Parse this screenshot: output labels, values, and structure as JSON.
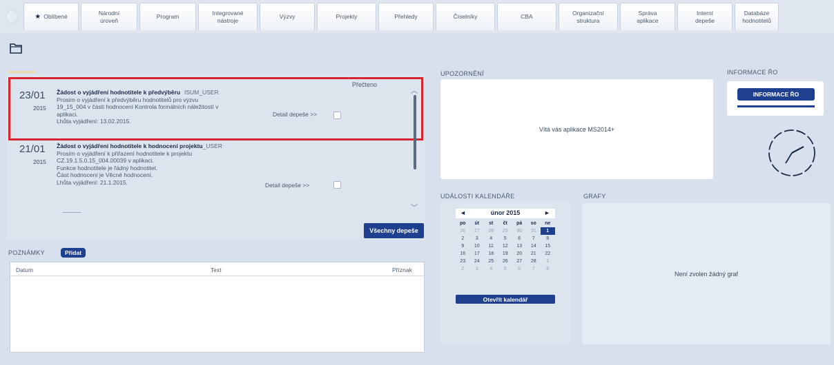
{
  "nav": {
    "tabs": [
      {
        "label": "Oblíbené",
        "icon": "star-icon"
      },
      {
        "label": "Národní\núroveň"
      },
      {
        "label": "Program"
      },
      {
        "label": "Integrované\nnástroje"
      },
      {
        "label": "Výzvy"
      },
      {
        "label": "Projekty"
      },
      {
        "label": "Přehledy"
      },
      {
        "label": "Číselníky"
      },
      {
        "label": "CBA"
      },
      {
        "label": "Organizační\nstruktura"
      },
      {
        "label": "Správa\naplikace"
      },
      {
        "label": "Interní\ndepeše"
      },
      {
        "label": "Databáze\nhodnotitelů"
      }
    ]
  },
  "messages": {
    "read_label": "Přečteno",
    "items": [
      {
        "day": "23/01",
        "year": "2015",
        "subject": "Žádost o vyjádření hodnotitele k předvýběru",
        "sender": "ISUM_USER",
        "lines": [
          "Prosím o vyjádření k předvýběru hodnotitelů pro výzvu",
          "19_15_004 v části hodnocení Kontrola formálních náležitostí v",
          "aplikaci.",
          "Lhůta vyjádření: 13.02.2015."
        ],
        "detail_link": "Detail depeše >>"
      },
      {
        "day": "21/01",
        "year": "2015",
        "subject": "Žádost o vyjádření hodnotitele k hodnocení projektu",
        "sender": "_USER",
        "lines": [
          "Prosím o vyjádření k přiřazení hodnotitele k projektu",
          "CZ.19.1.5.0.15_004.00039 v aplikaci.",
          "Funkce hodnotitele je řádný hodnotitel.",
          "Část hodnocení je Věcné hodnocení.",
          "Lhůta vyjádření: 21.1.2015."
        ],
        "detail_link": "Detail depeše >>"
      }
    ],
    "all_button": "Všechny depeše"
  },
  "notes": {
    "title": "POZNÁMKY",
    "add_button": "Přidat",
    "columns": [
      "Datum",
      "Text",
      "Příznak"
    ]
  },
  "notices": {
    "title": "UPOZORNĚNÍ",
    "message": "Vítá vás aplikace MS2014+"
  },
  "info": {
    "title": "INFORMACE ŘO",
    "button": "INFORMACE ŘO"
  },
  "calendar": {
    "title": "UDÁLOSTI KALENDÁŘE",
    "prev": "◄",
    "next": "►",
    "month": "únor 2015",
    "weekdays": [
      "po",
      "út",
      "st",
      "čt",
      "pá",
      "so",
      "ne"
    ],
    "weeks": [
      [
        {
          "d": "26",
          "m": true
        },
        {
          "d": "27",
          "m": true
        },
        {
          "d": "28",
          "m": true
        },
        {
          "d": "29",
          "m": true
        },
        {
          "d": "30",
          "m": true
        },
        {
          "d": "31",
          "m": true
        },
        {
          "d": "1",
          "sel": true
        }
      ],
      [
        {
          "d": "2"
        },
        {
          "d": "3"
        },
        {
          "d": "4"
        },
        {
          "d": "5"
        },
        {
          "d": "6"
        },
        {
          "d": "7"
        },
        {
          "d": "8"
        }
      ],
      [
        {
          "d": "9"
        },
        {
          "d": "10"
        },
        {
          "d": "11"
        },
        {
          "d": "12"
        },
        {
          "d": "13"
        },
        {
          "d": "14"
        },
        {
          "d": "15"
        }
      ],
      [
        {
          "d": "16"
        },
        {
          "d": "17"
        },
        {
          "d": "18"
        },
        {
          "d": "19"
        },
        {
          "d": "20"
        },
        {
          "d": "21"
        },
        {
          "d": "22"
        }
      ],
      [
        {
          "d": "23"
        },
        {
          "d": "24"
        },
        {
          "d": "25"
        },
        {
          "d": "26"
        },
        {
          "d": "27"
        },
        {
          "d": "28"
        },
        {
          "d": "1",
          "m": true
        }
      ],
      [
        {
          "d": "2",
          "m": true
        },
        {
          "d": "3",
          "m": true
        },
        {
          "d": "4",
          "m": true
        },
        {
          "d": "5",
          "m": true
        },
        {
          "d": "6",
          "m": true
        },
        {
          "d": "7",
          "m": true
        },
        {
          "d": "8",
          "m": true
        }
      ]
    ],
    "open_button": "Otevřít kalendář"
  },
  "charts": {
    "title": "GRAFY",
    "empty": "Není zvolen žádný graf"
  },
  "colors": {
    "accent": "#1f3f8f",
    "highlight": "#d9232e",
    "background": "#d7e0ec"
  }
}
